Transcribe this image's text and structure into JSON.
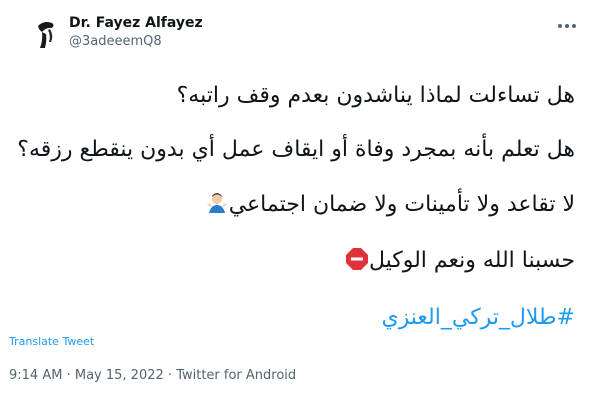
{
  "tweet": {
    "author_name": "Dr. Fayez Alfayez",
    "author_handle": "@3adeeemQ8",
    "lines": [
      "هل تساءلت لماذا يناشدون بعدم وقف راتبه؟",
      "هل تعلم بأنه بمجرد وفاة أو ايقاف عمل أي بدون ينقطع رزقه؟",
      "لا تقاعد ولا تأمينات ولا ضمان اجتماعي",
      "حسبنا الله ونعم الوكيل",
      "#طلال_تركي_العنزي"
    ],
    "translate_label": "Translate Tweet",
    "time": "9:14 AM",
    "date": "May 15, 2022",
    "source": "Twitter for Android",
    "separator": "·"
  },
  "icons": {
    "avatar": "avatar-icon",
    "more": "more-options-icon",
    "shrug": "man-shrugging-emoji",
    "stop": "stop-sign-emoji"
  },
  "colors": {
    "link": "#1d9bf0",
    "secondary_text": "#536471",
    "primary_text": "#0f1419",
    "stop_sign": "#e0323b"
  }
}
